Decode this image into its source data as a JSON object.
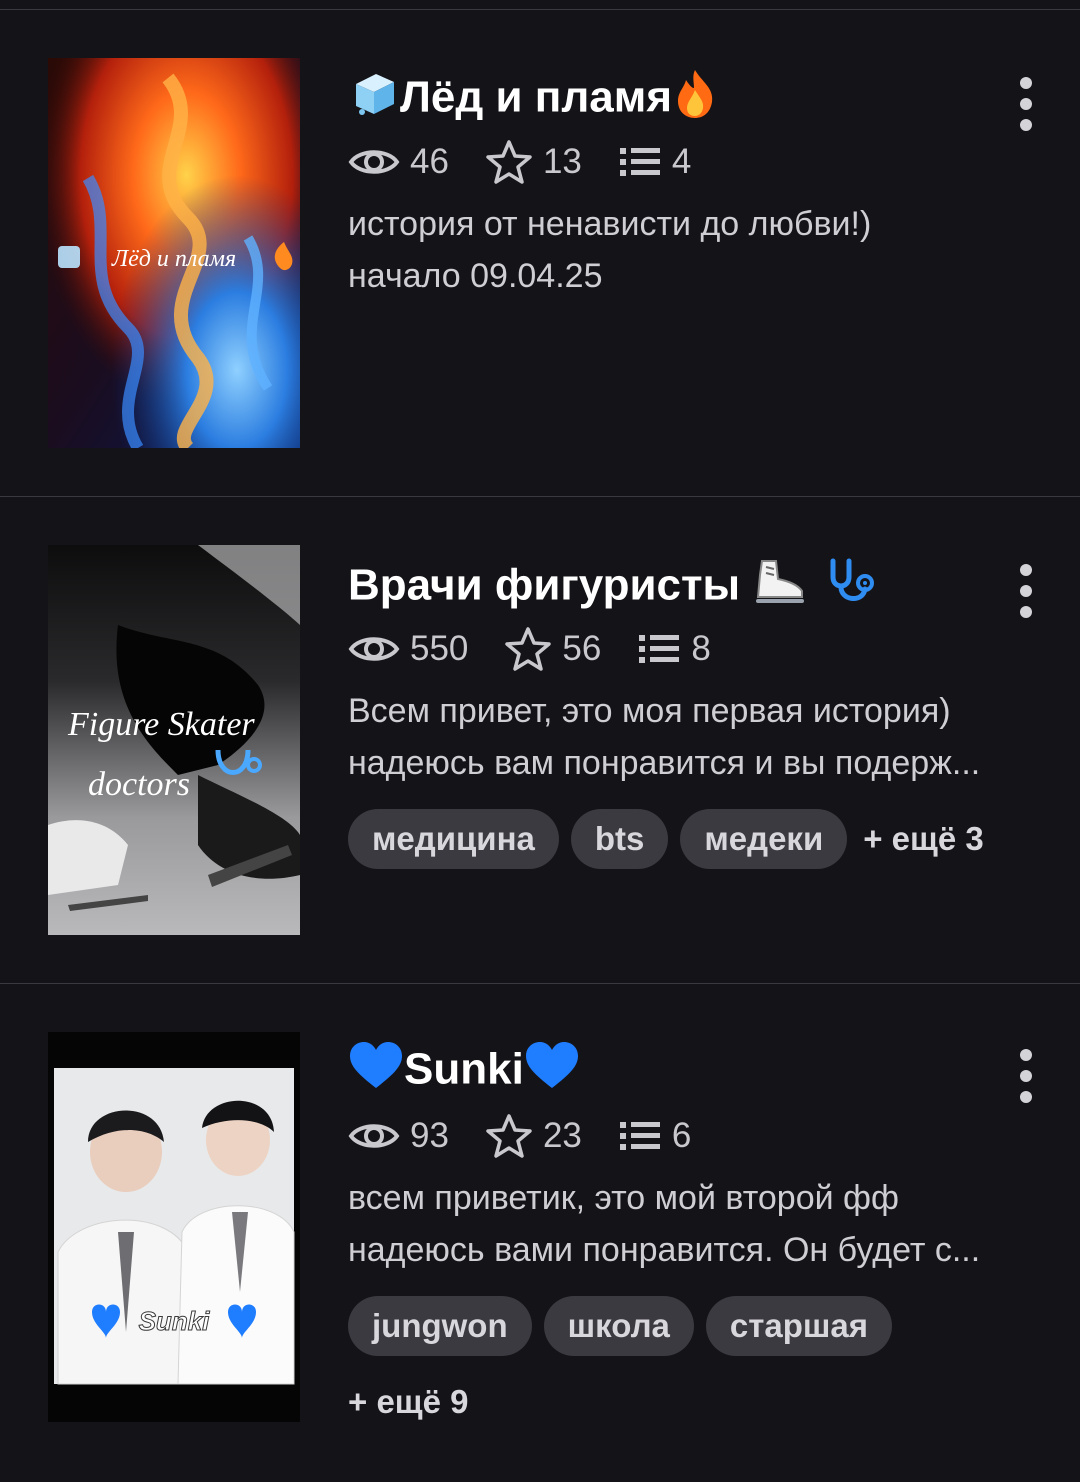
{
  "stories": [
    {
      "title_prefix_icon": "ice-cube-emoji",
      "title": "Лёд и пламя",
      "title_suffix_icon": "fire-emoji",
      "views": "46",
      "stars": "13",
      "chapters": "4",
      "description_lines": [
        "история от ненависти до любви!)",
        "начало 09.04.25"
      ],
      "cover_caption": "Лёд и пламя",
      "tags": [],
      "more_tags": ""
    },
    {
      "title": "Врачи фигуристы",
      "title_suffix_icons": [
        "ice-skate-emoji",
        "stethoscope-emoji"
      ],
      "views": "550",
      "stars": "56",
      "chapters": "8",
      "description_lines": [
        "Всем привет, это моя первая история)",
        "надеюсь вам понравится и вы подерж..."
      ],
      "cover_caption_line1": "Figure Skater",
      "cover_caption_line2": "doctors",
      "tags": [
        "медицина",
        "bts",
        "медеки"
      ],
      "more_tags": "+ ещё 3"
    },
    {
      "title_prefix_icon": "blue-heart-emoji",
      "title": "Sunki",
      "title_suffix_icon": "blue-heart-emoji",
      "views": "93",
      "stars": "23",
      "chapters": "6",
      "description_lines": [
        "всем приветик, это мой второй фф",
        "надеюсь вами понравится. Он будет с..."
      ],
      "cover_caption": "Sunki",
      "tags": [
        "jungwon",
        "школа",
        "старшая"
      ],
      "more_tags": "+ ещё 9"
    }
  ],
  "colors": {
    "background": "#141317",
    "tag_bg": "#3b3a40",
    "muted_text": "#c9c8cd"
  }
}
